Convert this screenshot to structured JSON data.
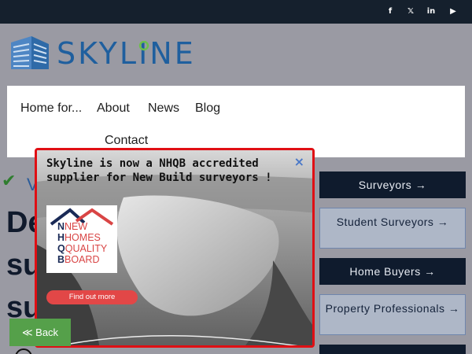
{
  "topbar": {
    "social_icons": [
      "facebook-icon",
      "x-twitter-icon",
      "linkedin-icon",
      "youtube-icon"
    ],
    "social_glyphs": [
      "f",
      "𝕏",
      "in",
      "▶"
    ]
  },
  "logo": {
    "text": "SKYLINE"
  },
  "nav": {
    "items": [
      "Home for...",
      "About",
      "News",
      "Blog",
      "Contact"
    ]
  },
  "hero": {
    "partial_line1": "De",
    "partial_line2": "su",
    "partial_line3": "su",
    "peek_letter": "V"
  },
  "modal": {
    "title": "Skyline is now a NHQB accredited supplier for New Build surveyors !",
    "close": "×",
    "logo_text": [
      "NEW",
      "HOMES",
      "QUALITY",
      "BOARD"
    ],
    "logo_initials": [
      "N",
      "H",
      "Q",
      "B"
    ],
    "cta": "Find out more"
  },
  "sidebar": {
    "buttons": [
      {
        "label": "Surveyors →",
        "style": "dark"
      },
      {
        "label": "Student Surveyors →",
        "style": "light"
      },
      {
        "label": "Home Buyers →",
        "style": "dark"
      },
      {
        "label": "Property Professionals →",
        "style": "light"
      }
    ]
  },
  "back": {
    "label": "≪ Back"
  },
  "colors": {
    "topbar": "#15202d",
    "navy_button": "#0f1b2d",
    "modal_border": "#e00f14",
    "brand_blue": "#1f5f9e",
    "back_green": "#55a04a"
  }
}
